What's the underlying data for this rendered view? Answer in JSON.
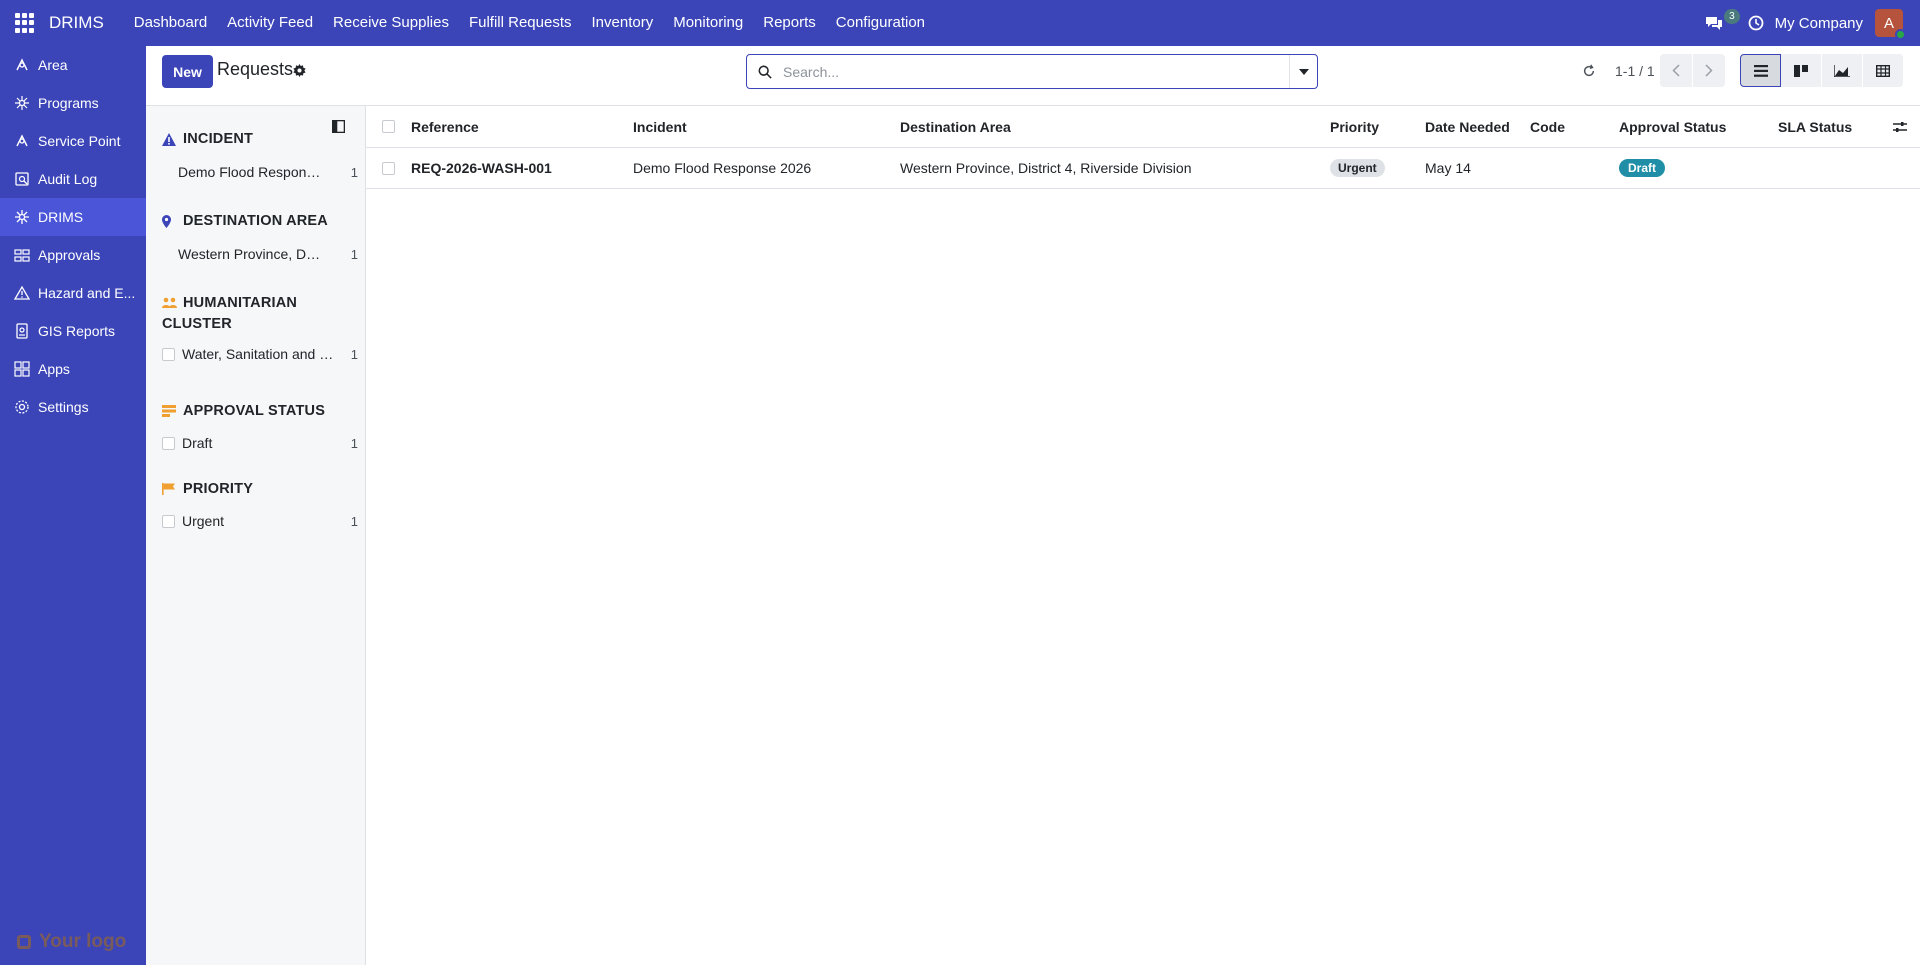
{
  "app": {
    "brand": "DRIMS"
  },
  "topnav": {
    "items": [
      "Dashboard",
      "Activity Feed",
      "Receive Supplies",
      "Fulfill Requests",
      "Inventory",
      "Monitoring",
      "Reports",
      "Configuration"
    ],
    "chat_count": "3",
    "company": "My Company",
    "avatar_initial": "A"
  },
  "sidebar": {
    "items": [
      {
        "label": "Area",
        "icon": "area-icon"
      },
      {
        "label": "Programs",
        "icon": "programs-icon"
      },
      {
        "label": "Service Point",
        "icon": "service-point-icon"
      },
      {
        "label": "Audit Log",
        "icon": "audit-log-icon"
      },
      {
        "label": "DRIMS",
        "icon": "drims-icon",
        "active": true
      },
      {
        "label": "Approvals",
        "icon": "approvals-icon"
      },
      {
        "label": "Hazard and E...",
        "icon": "hazard-icon"
      },
      {
        "label": "GIS Reports",
        "icon": "gis-reports-icon"
      },
      {
        "label": "Apps",
        "icon": "apps-icon"
      },
      {
        "label": "Settings",
        "icon": "settings-icon"
      }
    ],
    "logo_text": "Your logo"
  },
  "control": {
    "new_label": "New",
    "title": "Requests",
    "search_placeholder": "Search...",
    "pager": "1-1 / 1"
  },
  "search_panel": {
    "incident": {
      "title": "INCIDENT",
      "items": [
        {
          "label": "Demo Flood Response 2026",
          "count": "1"
        }
      ]
    },
    "destination": {
      "title": "DESTINATION AREA",
      "items": [
        {
          "label": "Western Province, District 4, Riverside Division",
          "count": "1"
        }
      ]
    },
    "cluster": {
      "title_line1": "HUMANITARIAN",
      "title_line2": "CLUSTER",
      "items": [
        {
          "label": "Water, Sanitation and Hygiene",
          "count": "1"
        }
      ]
    },
    "approval": {
      "title": "APPROVAL STATUS",
      "items": [
        {
          "label": "Draft",
          "count": "1"
        }
      ]
    },
    "priority": {
      "title": "PRIORITY",
      "items": [
        {
          "label": "Urgent",
          "count": "1"
        }
      ]
    }
  },
  "table": {
    "columns": [
      "Reference",
      "Incident",
      "Destination Area",
      "Priority",
      "Date Needed",
      "Code",
      "Approval Status",
      "SLA Status"
    ],
    "rows": [
      {
        "reference": "REQ-2026-WASH-001",
        "incident": "Demo Flood Response 2026",
        "destination": "Western Province, District 4, Riverside Division",
        "priority": "Urgent",
        "date_needed": "May 14",
        "code": "",
        "approval_status": "Draft",
        "sla_status": ""
      }
    ]
  },
  "colors": {
    "primary": "#3b45b8",
    "active_sidebar": "#4a55d8",
    "draft_badge": "#1f8ea6",
    "section_icon": "#f0a030"
  }
}
